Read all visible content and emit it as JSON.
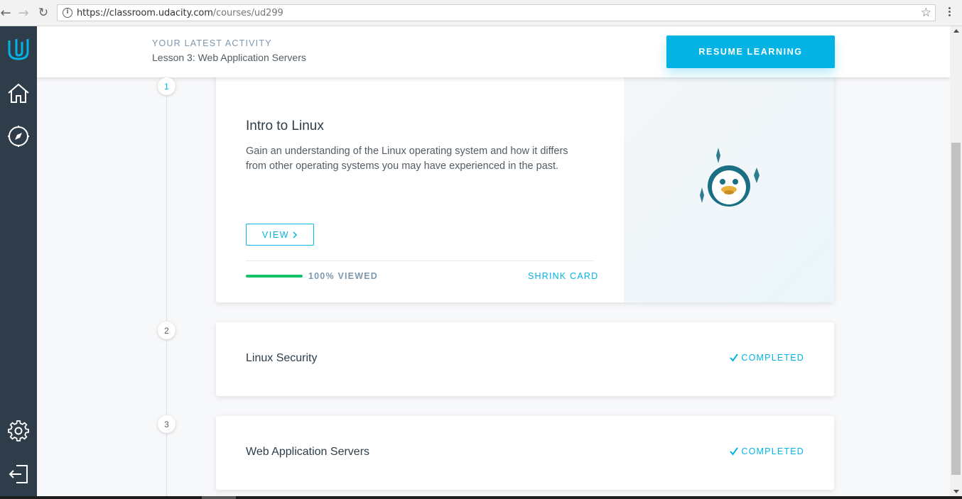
{
  "browser": {
    "url_host": "https://classroom.udacity.com",
    "url_path": "/courses/ud299"
  },
  "sidebar": {
    "items": [
      {
        "icon": "udacity-logo-icon"
      },
      {
        "icon": "home-icon"
      },
      {
        "icon": "compass-icon"
      },
      {
        "icon": "gear-icon"
      },
      {
        "icon": "logout-icon"
      }
    ]
  },
  "activity": {
    "label": "YOUR LATEST ACTIVITY",
    "lesson": "Lesson 3: Web Application Servers",
    "resume_label": "RESUME LEARNING"
  },
  "lessons": [
    {
      "number": "1",
      "title": "Intro to Linux",
      "description": "Gain an understanding of the Linux operating system and how it differs from other operating systems you may have experienced in the past.",
      "view_label": "VIEW",
      "progress": 1.0,
      "progress_text": "100% VIEWED",
      "shrink_label": "SHRINK CARD",
      "illustration": "penguin-icon"
    },
    {
      "number": "2",
      "title": "Linux Security",
      "status": "COMPLETED"
    },
    {
      "number": "3",
      "title": "Web Application Servers",
      "status": "COMPLETED"
    }
  ],
  "colors": {
    "accent": "#02b3e4",
    "sidebar": "#2e3d49",
    "progress": "#15c26b"
  }
}
